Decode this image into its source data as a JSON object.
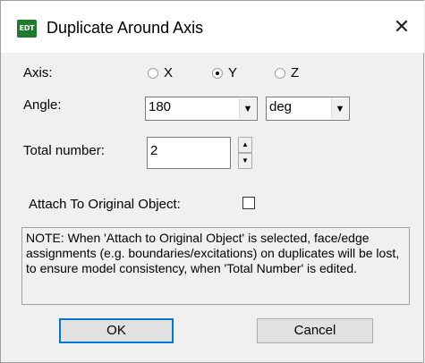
{
  "window": {
    "title": "Duplicate Around Axis",
    "icon_text": "EDT",
    "close_glyph": "✕"
  },
  "axis": {
    "label": "Axis:",
    "options": [
      "X",
      "Y",
      "Z"
    ],
    "selected": "Y"
  },
  "angle": {
    "label": "Angle:",
    "value": "180",
    "unit": "deg"
  },
  "total_number": {
    "label": "Total number:",
    "value": "2"
  },
  "attach": {
    "label": "Attach To Original Object:",
    "checked": false
  },
  "note": {
    "text": "NOTE:  When 'Attach to Original Object' is selected, face/edge assignments (e.g. boundaries/excitations) on duplicates will be lost, to ensure model consistency, when 'Total Number' is edited."
  },
  "buttons": {
    "ok": "OK",
    "cancel": "Cancel"
  },
  "icons": {
    "dropdown": "dropdown-arrow-icon",
    "spin_up": "spin-up-icon",
    "spin_down": "spin-down-icon"
  },
  "colors": {
    "icon_bg": "#1f7a2e",
    "titlebar_bg": "#ffffff",
    "dialog_bg": "#f0f0f0",
    "default_button_border": "#0078d7"
  }
}
